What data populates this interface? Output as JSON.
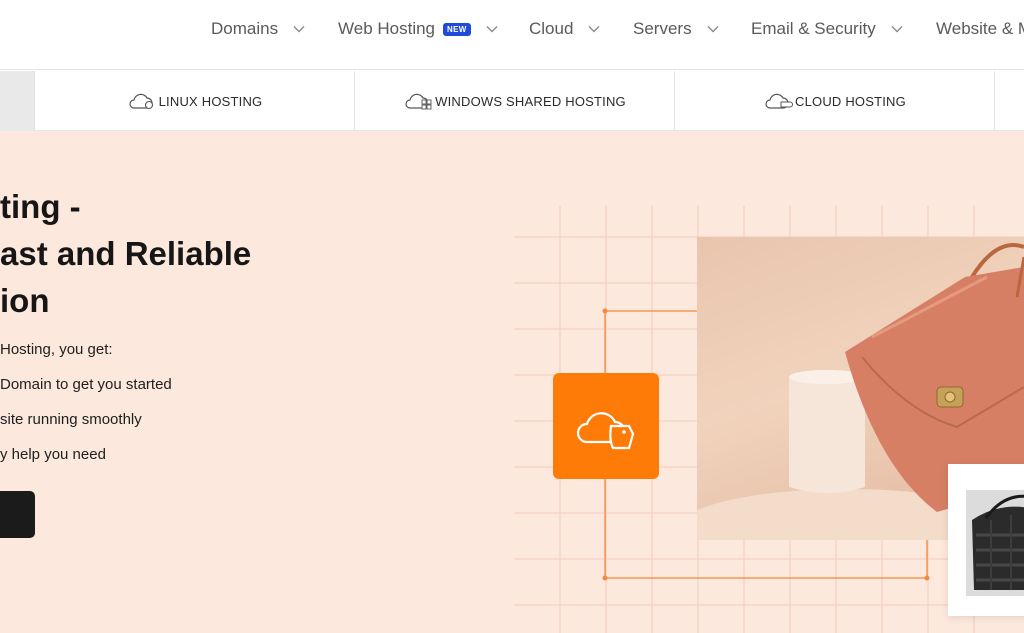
{
  "nav": {
    "items": [
      {
        "label": "Domains"
      },
      {
        "label": "Web Hosting",
        "badge": "NEW"
      },
      {
        "label": "Cloud"
      },
      {
        "label": "Servers"
      },
      {
        "label": "Email & Security"
      },
      {
        "label": "Website & M"
      }
    ]
  },
  "subtabs": [
    {
      "label": "LINUX HOSTING",
      "icon": "cloud-linux-icon"
    },
    {
      "label": "WINDOWS SHARED HOSTING",
      "icon": "cloud-windows-icon"
    },
    {
      "label": "CLOUD HOSTING",
      "icon": "cloud-icon"
    }
  ],
  "hero": {
    "title_lines": [
      "ting -",
      "ast and Reliable",
      "ion"
    ],
    "intro": "Hosting, you get:",
    "benefits": [
      "Domain to get you started",
      "site running smoothly",
      "y help you need"
    ]
  },
  "colors": {
    "accent": "#ff7b07",
    "hero_bg": "#fde8dd",
    "badge": "#1f4bd8",
    "dark": "#1b1b1b"
  }
}
